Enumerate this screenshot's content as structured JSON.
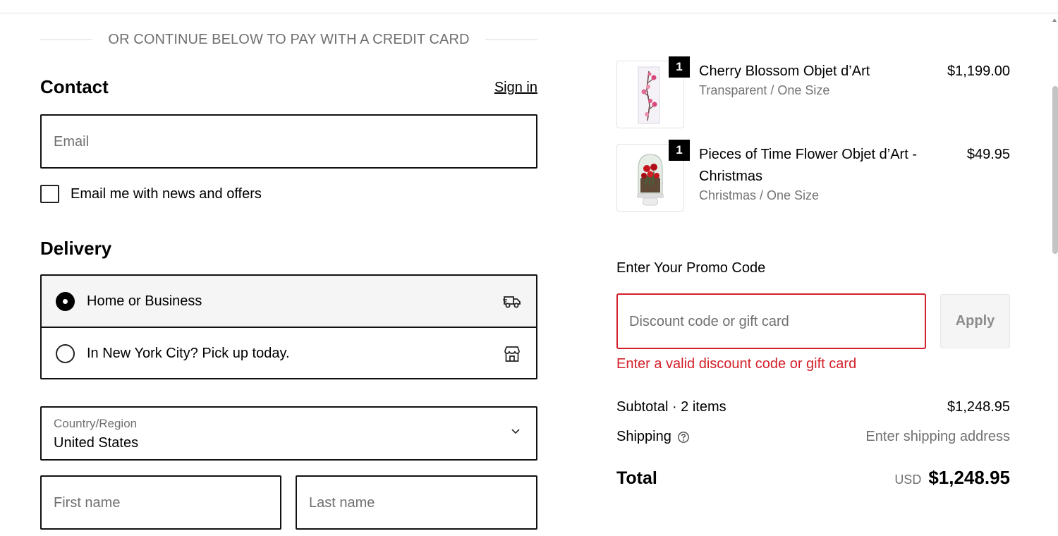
{
  "divider_text": "OR CONTINUE BELOW TO PAY WITH A CREDIT CARD",
  "contact": {
    "title": "Contact",
    "sign_in": "Sign in",
    "email_placeholder": "Email",
    "newsletter_label": "Email me with news and offers",
    "newsletter_checked": false
  },
  "delivery": {
    "title": "Delivery",
    "options": [
      {
        "label": "Home or Business",
        "selected": true,
        "icon": "delivery-truck-icon"
      },
      {
        "label": "In New York City? Pick up today.",
        "selected": false,
        "icon": "store-icon"
      }
    ],
    "country_label": "Country/Region",
    "country_value": "United States",
    "first_name_placeholder": "First name",
    "last_name_placeholder": "Last name"
  },
  "cart": {
    "items": [
      {
        "name": "Cherry Blossom Objet d’Art",
        "variant": "Transparent / One Size",
        "price": "$1,199.00",
        "quantity": "1"
      },
      {
        "name_line1": "Pieces of Time Flower Objet d’Art -",
        "name_line2": "Christmas",
        "variant": "Christmas / One Size",
        "price": "$49.95",
        "quantity": "1"
      }
    ]
  },
  "promo": {
    "label": "Enter Your Promo Code",
    "placeholder": "Discount code or gift card",
    "apply": "Apply",
    "error": "Enter a valid discount code or gift card"
  },
  "summary": {
    "subtotal_label": "Subtotal · 2 items",
    "subtotal_value": "$1,248.95",
    "shipping_label": "Shipping",
    "shipping_value": "Enter shipping address",
    "total_label": "Total",
    "currency": "USD",
    "total_value": "$1,248.95"
  },
  "colors": {
    "error": "#d3202a",
    "muted_text": "#707070",
    "border": "#111111",
    "selected_bg": "#f5f5f5"
  }
}
